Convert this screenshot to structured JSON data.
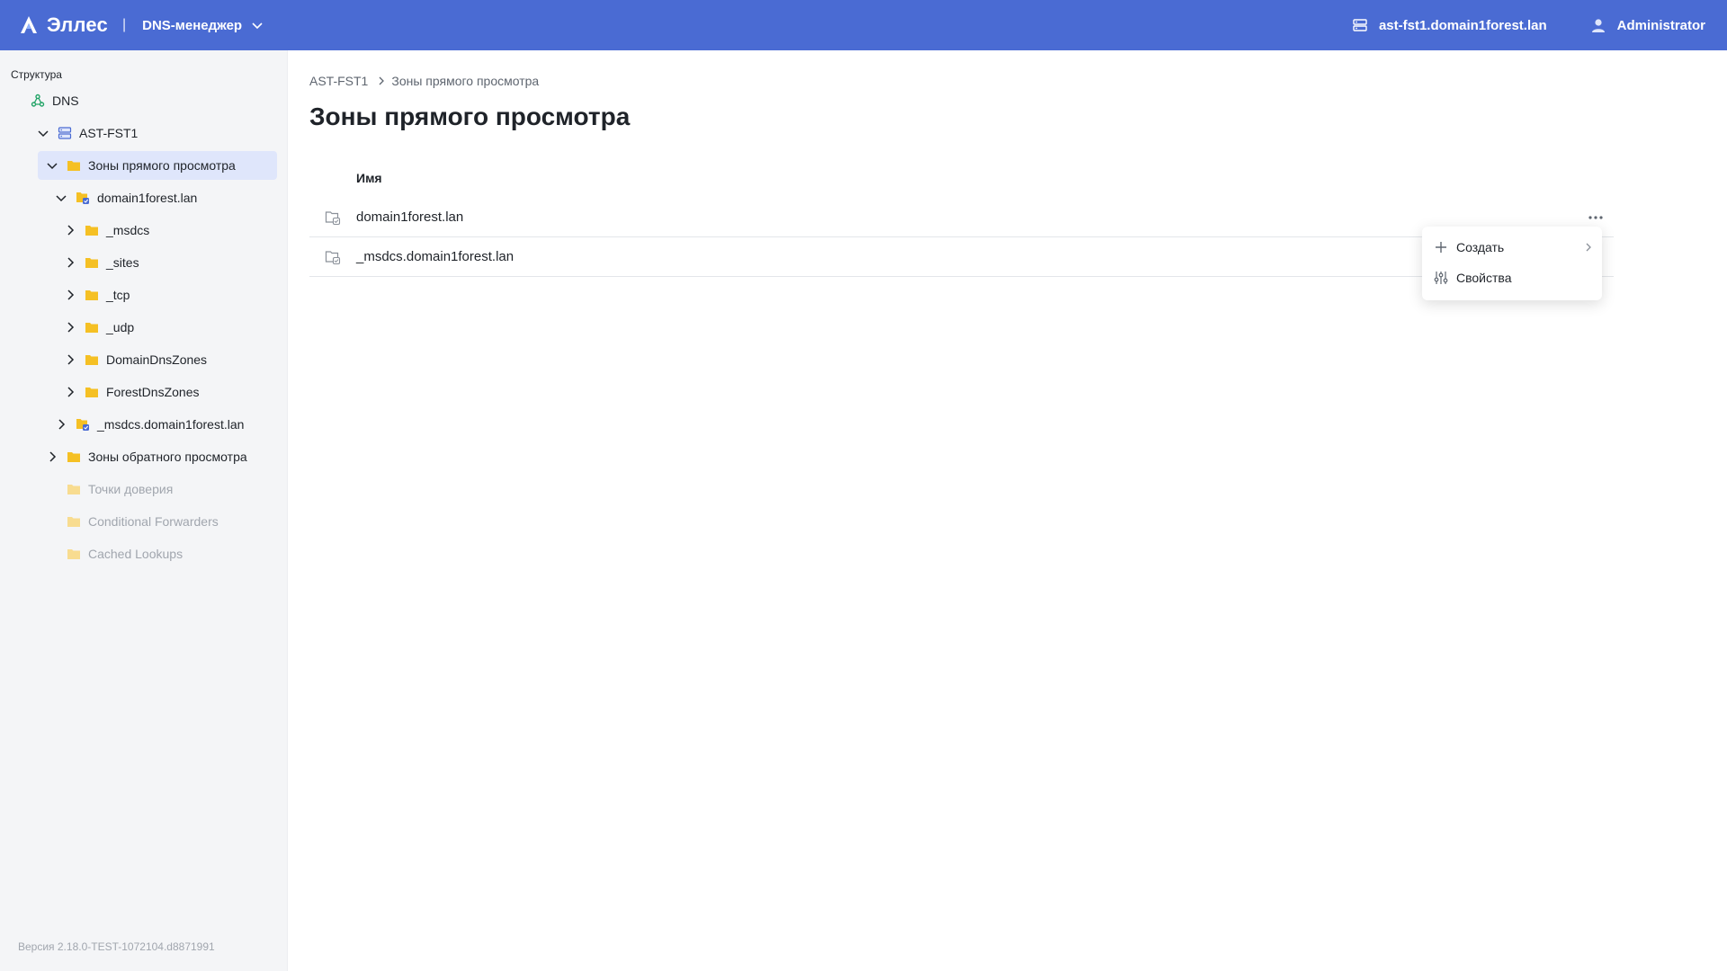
{
  "header": {
    "brand": "Эллес",
    "separator": "|",
    "app_name": "DNS-менеджер",
    "server": "ast-fst1.domain1forest.lan",
    "user": "Administrator",
    "colors": {
      "bar": "#4a6bd3"
    }
  },
  "sidebar": {
    "title": "Структура",
    "items": [
      {
        "label": "DNS",
        "icon": "dns-icon"
      },
      {
        "label": "AST-FST1",
        "icon": "server-icon",
        "expanded": true
      },
      {
        "label": "Зоны прямого просмотра",
        "icon": "folder-icon",
        "expanded": true,
        "selected": true
      },
      {
        "label": "domain1forest.lan",
        "icon": "zone-icon",
        "expanded": true
      },
      {
        "label": "_msdcs",
        "icon": "folder-icon"
      },
      {
        "label": "_sites",
        "icon": "folder-icon"
      },
      {
        "label": "_tcp",
        "icon": "folder-icon"
      },
      {
        "label": "_udp",
        "icon": "folder-icon"
      },
      {
        "label": "DomainDnsZones",
        "icon": "folder-icon"
      },
      {
        "label": "ForestDnsZones",
        "icon": "folder-icon"
      },
      {
        "label": "_msdcs.domain1forest.lan",
        "icon": "zone-icon"
      },
      {
        "label": "Зоны обратного просмотра",
        "icon": "folder-icon"
      },
      {
        "label": "Точки доверия",
        "icon": "folder-icon",
        "disabled": true
      },
      {
        "label": "Conditional Forwarders",
        "icon": "folder-icon",
        "disabled": true
      },
      {
        "label": "Cached Lookups",
        "icon": "folder-icon",
        "disabled": true
      }
    ],
    "version": "Версия 2.18.0-TEST-1072104.d8871991"
  },
  "main": {
    "breadcrumb": [
      "AST-FST1",
      "Зоны прямого просмотра"
    ],
    "title": "Зоны прямого просмотра",
    "table": {
      "header": "Имя",
      "rows": [
        "domain1forest.lan",
        "_msdcs.domain1forest.lan"
      ]
    }
  },
  "context_menu": {
    "items": [
      {
        "label": "Создать",
        "icon": "plus-icon",
        "has_submenu": true
      },
      {
        "label": "Свойства",
        "icon": "sliders-icon"
      }
    ]
  }
}
